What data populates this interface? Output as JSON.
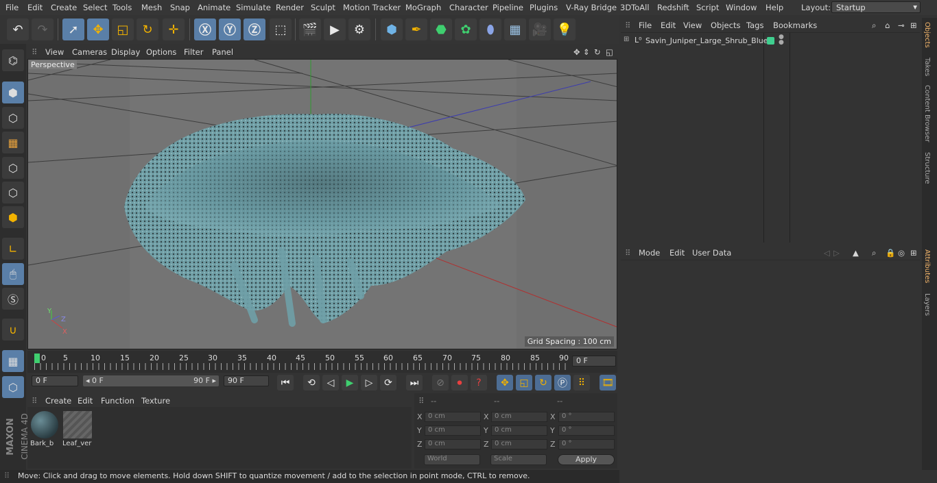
{
  "menu": [
    "File",
    "Edit",
    "Create",
    "Select",
    "Tools",
    "Mesh",
    "Snap",
    "Animate",
    "Simulate",
    "Render",
    "Sculpt",
    "Motion Tracker",
    "MoGraph",
    "Character",
    "Pipeline",
    "Plugins",
    "V-Ray Bridge",
    "3DToAll",
    "Redshift",
    "Script",
    "Window",
    "Help"
  ],
  "layout": {
    "label": "Layout:",
    "value": "Startup"
  },
  "viewport": {
    "menu": [
      "View",
      "Cameras",
      "Display",
      "Options",
      "Filter",
      "Panel"
    ],
    "camera": "Perspective",
    "grid_spacing": "Grid Spacing : 100 cm",
    "axis_labels": {
      "y": "Y",
      "z": "Z",
      "x": "X"
    }
  },
  "timeline": {
    "ticks": [
      "0",
      "5",
      "10",
      "15",
      "20",
      "25",
      "30",
      "35",
      "40",
      "45",
      "50",
      "55",
      "60",
      "65",
      "70",
      "75",
      "80",
      "85",
      "90"
    ],
    "current_frame": "0 F",
    "start": "0 F",
    "range_start": "◂ 0 F",
    "range_end": "90 F ▸",
    "end": "90 F"
  },
  "materials": {
    "menu": [
      "Create",
      "Edit",
      "Function",
      "Texture"
    ],
    "items": [
      {
        "name": "Bark_b"
      },
      {
        "name": "Leaf_ver"
      }
    ]
  },
  "coords": {
    "headers": [
      "--",
      "--",
      "--"
    ],
    "rows": [
      {
        "a": "X",
        "av": "0 cm",
        "b": "X",
        "bv": "0 cm",
        "c": "X",
        "cv": "0 °"
      },
      {
        "a": "Y",
        "av": "0 cm",
        "b": "Y",
        "bv": "0 cm",
        "c": "Y",
        "cv": "0 °"
      },
      {
        "a": "Z",
        "av": "0 cm",
        "b": "Z",
        "bv": "0 cm",
        "c": "Z",
        "cv": "0 °"
      }
    ],
    "mode": "World",
    "transform": "Scale",
    "apply": "Apply"
  },
  "objects": {
    "menu": [
      "File",
      "Edit",
      "View",
      "Objects",
      "Tags",
      "Bookmarks"
    ],
    "tree": [
      {
        "name": "Savin_Juniper_Large_Shrub_Blue"
      }
    ]
  },
  "attributes": {
    "menu": [
      "Mode",
      "Edit",
      "User Data"
    ]
  },
  "right_tabs": [
    "Objects",
    "Takes",
    "Content Browser",
    "Structure",
    "Attributes",
    "Layers"
  ],
  "status": "Move: Click and drag to move elements. Hold down SHIFT to quantize movement / add to the selection in point mode, CTRL to remove.",
  "brand": {
    "maxon": "MAXON",
    "product": "CINEMA 4D"
  },
  "colors": {
    "accent": "#5a7fa8",
    "shrub": "#5e8f97",
    "tab_active": "#f3b56b"
  }
}
